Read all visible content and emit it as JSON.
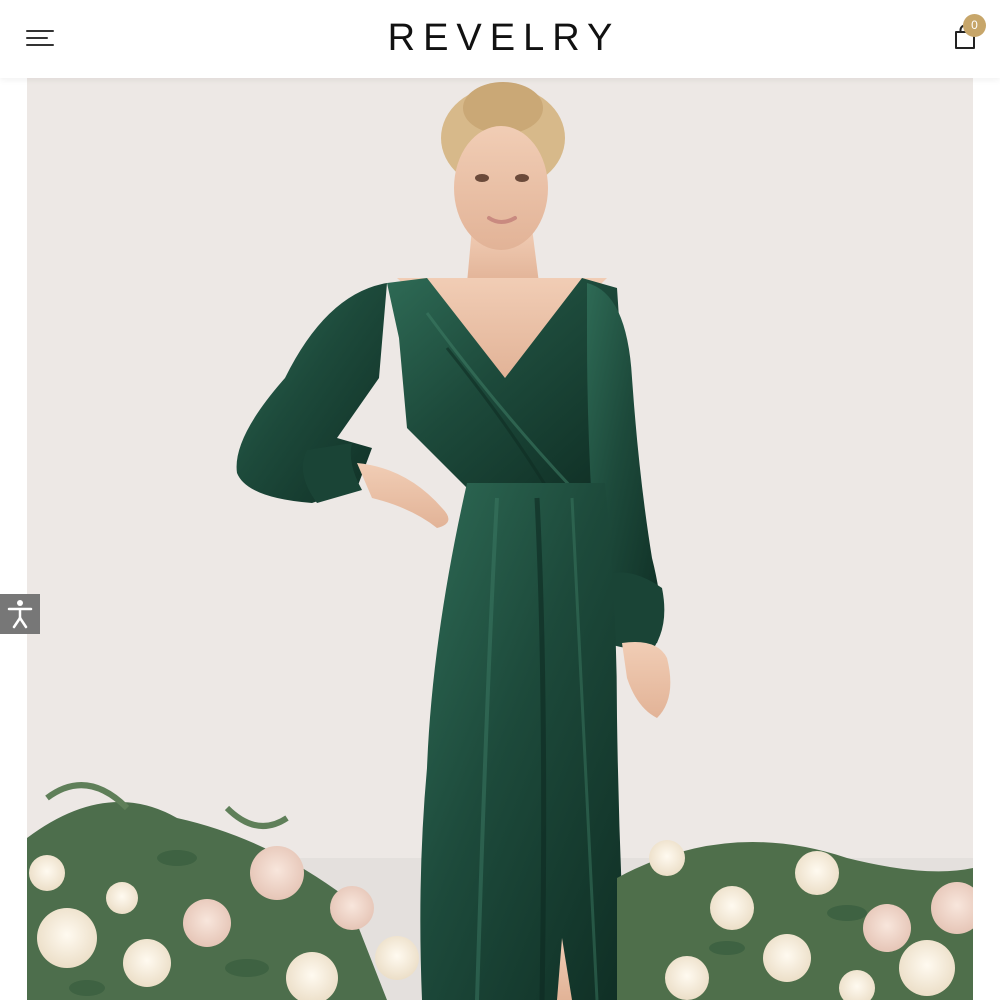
{
  "header": {
    "brand": "REVELRY",
    "menu_icon": "hamburger-menu-icon",
    "cart_icon": "shopping-bag-icon",
    "cart_count": "0"
  },
  "hero": {
    "image": "model-in-emerald-velvet-long-sleeve-gown-with-floral-arrangement",
    "dress_color": "#1f4a3c"
  },
  "accessibility": {
    "icon": "accessibility-person-icon"
  },
  "colors": {
    "accent": "#c7a66a",
    "header_bg": "#ffffff",
    "text": "#111111",
    "a11y_bg": "#777777"
  }
}
